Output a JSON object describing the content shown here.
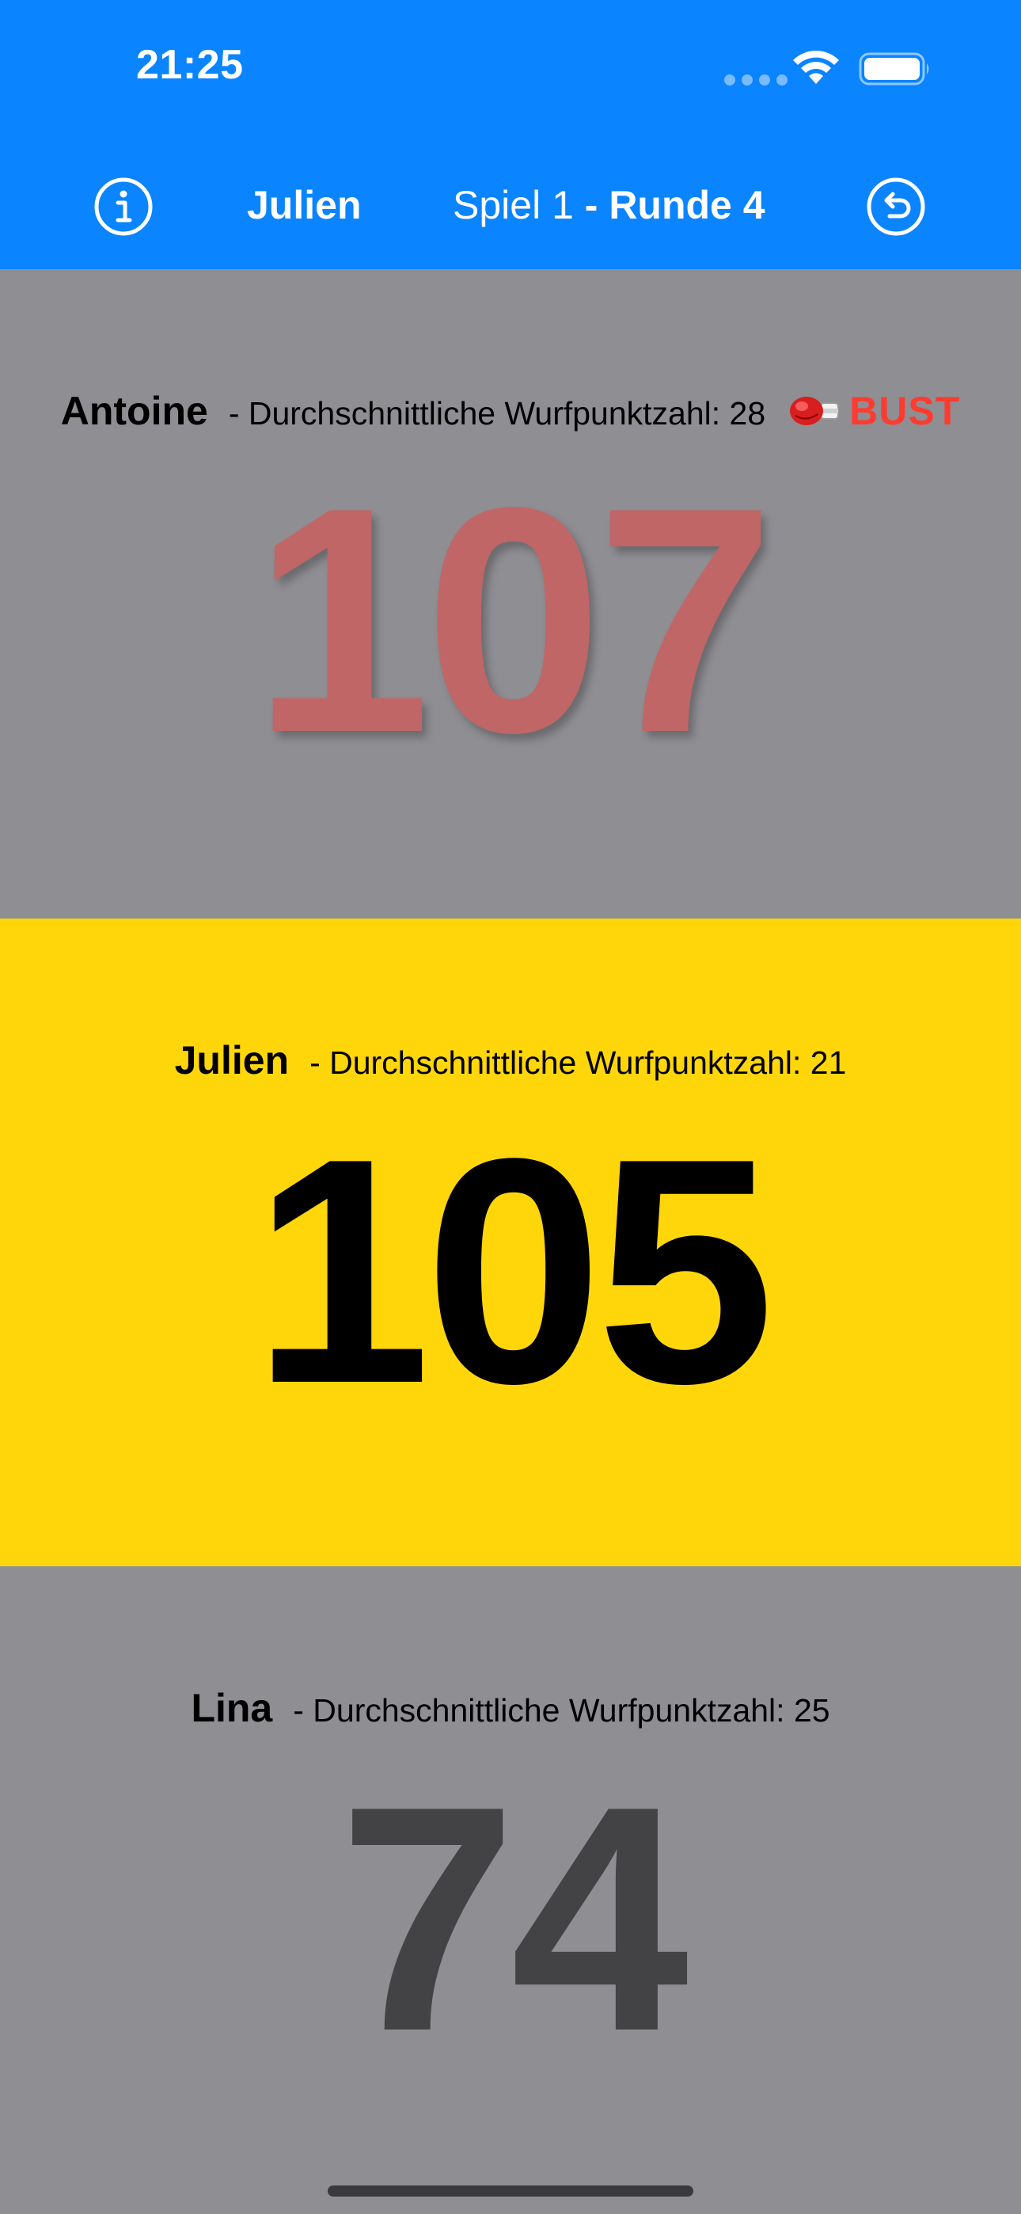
{
  "status_bar": {
    "time": "21:25"
  },
  "nav": {
    "info_icon": "info-circle-icon",
    "current_player": "Julien",
    "game_label": "Spiel 1",
    "round_label": " - Runde 4",
    "undo_icon": "undo-arrow-circle-icon"
  },
  "players": [
    {
      "name": "Antoine",
      "avg_text": "- Durchschnittliche Wurfpunktzahl: 28",
      "bust_icon": "boxing-glove-icon",
      "bust_label": "BUST",
      "score": "107"
    },
    {
      "name": "Julien",
      "avg_text": "- Durchschnittliche Wurfpunktzahl: 21",
      "score": "105"
    },
    {
      "name": "Lina",
      "avg_text": "- Durchschnittliche Wurfpunktzahl: 25",
      "score": "74"
    }
  ],
  "colors": {
    "header": "#0a84ff",
    "inactive_panel": "#8e8e93",
    "active_panel": "#ffd60a",
    "bust_score": "#c06666",
    "bust_text": "#ff3b30",
    "inactive_score": "#434345"
  }
}
